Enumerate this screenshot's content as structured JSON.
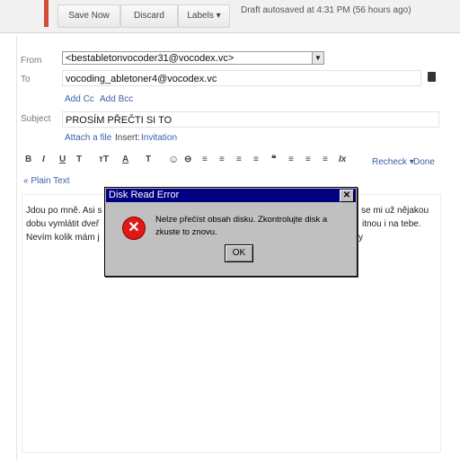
{
  "toolbar": {
    "save_label": "Save Now",
    "discard_label": "Discard",
    "labels_label": "Labels",
    "labels_arrow": "▾",
    "draft_status": "Draft autosaved at 4:31 PM (56 hours ago)"
  },
  "compose": {
    "from_label": "From",
    "from_value": "<bestabletonvocoder31@vocodex.vc>",
    "to_label": "To",
    "to_value": "vocoding_abletoner4@vocodex.vc",
    "add_cc": "Add Cc",
    "add_bcc": "Add Bcc",
    "subject_label": "Subject",
    "subject_value": "PROSÍM PŘEČTI SI TO",
    "attach_file": "Attach a file",
    "insert": "Insert:",
    "invitation": "Invitation",
    "recheck": "Recheck",
    "recheck_arrow": "▾",
    "done": "Done",
    "plain_text": "« Plain Text"
  },
  "format_toolbar": {
    "bold": "B",
    "italic": "I",
    "underline": "U",
    "font": "T",
    "size": "тT",
    "color": "A",
    "highlight": "T",
    "emoji": "☺",
    "link": "⊖",
    "numbered": "≡",
    "bullets": "≡",
    "indent_less": "≡",
    "indent_more": "≡",
    "quote": "❝",
    "align_left": "≡",
    "align_center": "≡",
    "align_right": "≡",
    "remove_format": "Ix"
  },
  "body": {
    "line1_left": "Jdou po mně. Asi s",
    "line1_right": "i se mi už nějakou",
    "line2_left": "dobu vymlátit dveř",
    "line2_right": "itnou i na tebe.",
    "line3_left": "Nevím kolik mám j",
    "line3_right": "y"
  },
  "dialog": {
    "title": "Disk Read Error",
    "close": "✕",
    "icon": "✕",
    "message": "Nelze přečíst obsah disku. Zkontrolujte disk a zkuste to znovu.",
    "ok_label": "OK"
  },
  "colors": {
    "accent": "#d44a3c",
    "link": "#3b63a8",
    "dialog_title_bar": "#000080",
    "dialog_bg": "#c0c0c0",
    "error_icon": "#e01818"
  }
}
